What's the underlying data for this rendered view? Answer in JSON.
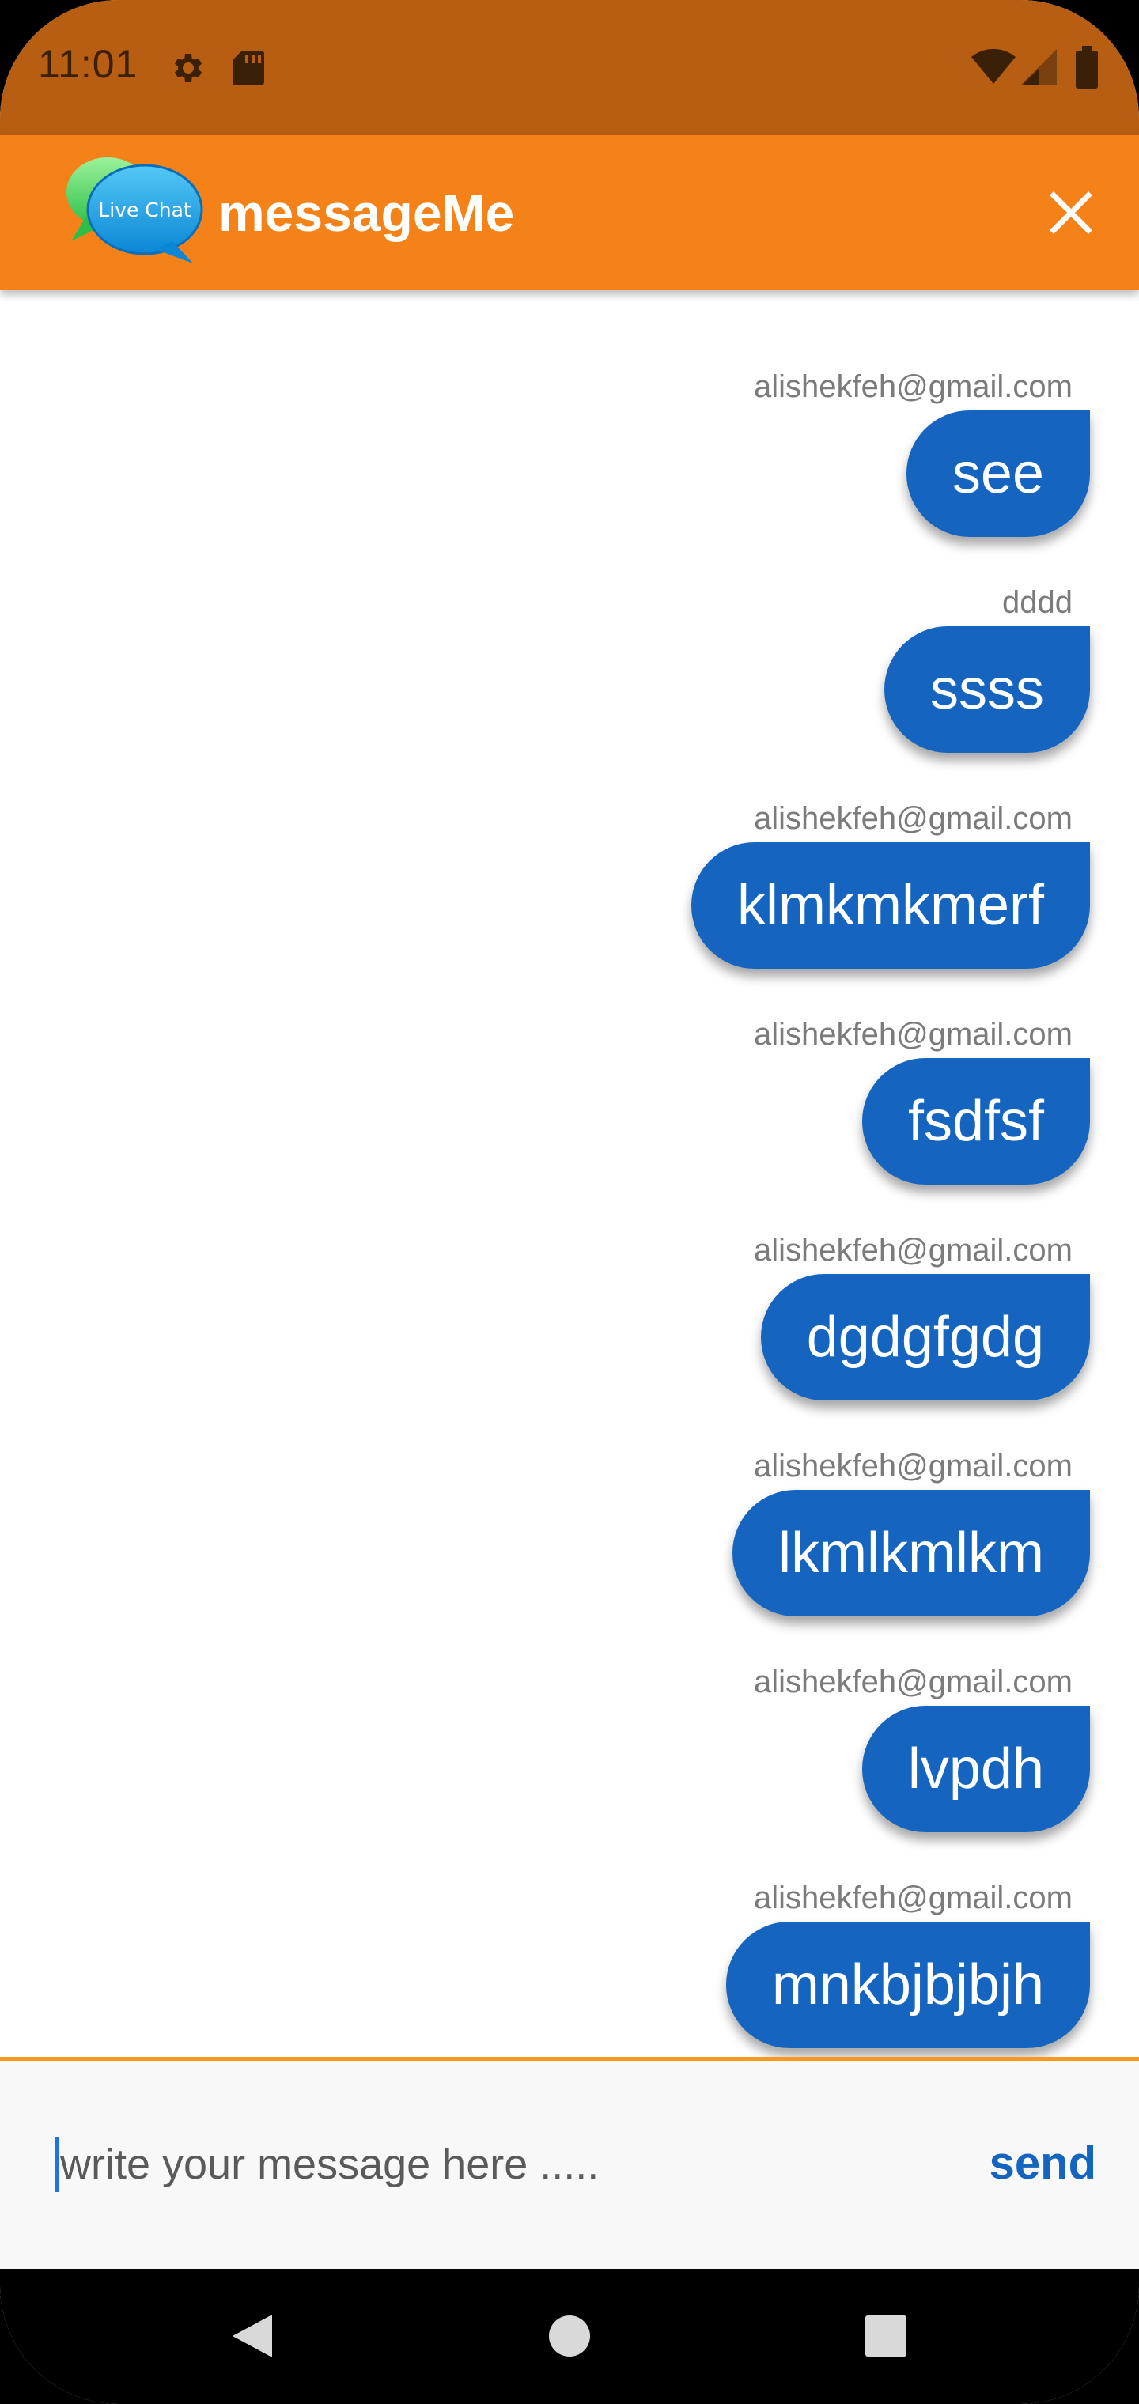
{
  "status_bar": {
    "time": "11:01",
    "icons": [
      "gear-icon",
      "sd-card-icon",
      "wifi-icon",
      "signal-icon",
      "battery-icon"
    ]
  },
  "app_bar": {
    "logo_text": "Live Chat",
    "title": "messageMe",
    "close_icon": "close-icon"
  },
  "messages": [
    {
      "sender": "alishekfeh@gmail.com",
      "text": "see"
    },
    {
      "sender": "dddd",
      "text": "ssss"
    },
    {
      "sender": "alishekfeh@gmail.com",
      "text": "klmkmkmerf"
    },
    {
      "sender": "alishekfeh@gmail.com",
      "text": "fsdfsf"
    },
    {
      "sender": "alishekfeh@gmail.com",
      "text": "dgdgfgdg"
    },
    {
      "sender": "alishekfeh@gmail.com",
      "text": "lkmlkmlkm"
    },
    {
      "sender": "alishekfeh@gmail.com",
      "text": "lvpdh"
    },
    {
      "sender": "alishekfeh@gmail.com",
      "text": "mnkbjbjbjh"
    }
  ],
  "composer": {
    "placeholder": "write your message here .....",
    "send_label": "send"
  },
  "nav_bar": {
    "icons": [
      "back-icon",
      "home-icon",
      "recents-icon"
    ]
  },
  "colors": {
    "status_bar": "#B75E12",
    "app_bar": "#F58218",
    "bubble": "#1565C0",
    "send": "#1565C0",
    "divider": "#F59A1E"
  }
}
